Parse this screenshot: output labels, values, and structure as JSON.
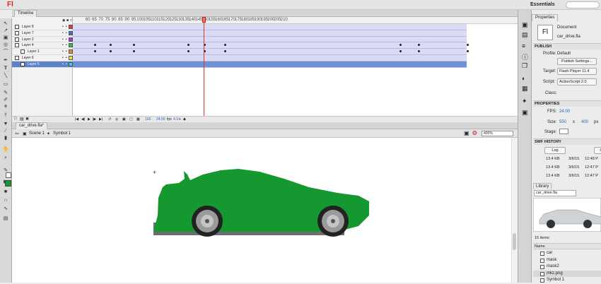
{
  "menubar": {
    "app_logo": "Fl",
    "workspace": "Essentials"
  },
  "timeline": {
    "tab_label": "Timeline",
    "ruler_ticks": [
      "60",
      "65",
      "70",
      "75",
      "80",
      "85",
      "90",
      "95",
      "100",
      "105",
      "110",
      "115",
      "120",
      "125",
      "130",
      "135",
      "140",
      "145",
      "150",
      "155",
      "160",
      "165",
      "170",
      "175",
      "180",
      "185",
      "190",
      "195",
      "200",
      "205",
      "210"
    ],
    "layers": [
      {
        "name": "Layer 8",
        "indent": 0,
        "color": "#e03a3a",
        "selected": false
      },
      {
        "name": "Layer 7",
        "indent": 0,
        "color": "#3a6ee0",
        "selected": false
      },
      {
        "name": "Layer 2",
        "indent": 0,
        "color": "#a03ad8",
        "selected": false
      },
      {
        "name": "Layer 4",
        "indent": 0,
        "color": "#2ec23a",
        "selected": false
      },
      {
        "name": "Layer 1",
        "indent": 1,
        "color": "#e08a2a",
        "selected": false
      },
      {
        "name": "Layer 6",
        "indent": 0,
        "color": "#e8e13a",
        "selected": false
      },
      {
        "name": "Layer 5",
        "indent": 1,
        "color": "#3ad2d2",
        "selected": true
      }
    ],
    "status": {
      "frame": "103",
      "fps": "24.00",
      "fps_unit": "fps",
      "time": "4.3",
      "time_unit": "s"
    }
  },
  "document": {
    "tab_label": "car_drive.fla*",
    "breadcrumb_scene": "Scene 1",
    "breadcrumb_symbol": "Symbol 1",
    "zoom": "400%"
  },
  "properties": {
    "tab_label": "Properties",
    "doc_icon_text": "Fl",
    "doc_type": "Document",
    "doc_name": "car_drive.fla",
    "publish": {
      "header": "PUBLISH",
      "profile_label": "Profile:",
      "profile_value": "Default",
      "settings_button": "Publish Settings...",
      "target_label": "Target:",
      "target_value": "Flash Player 11.4",
      "script_label": "Script:",
      "script_value": "ActionScript 2.0",
      "class_label": "Class:"
    },
    "props_section": {
      "header": "PROPERTIES",
      "fps_label": "FPS:",
      "fps_value": "24.00",
      "size_label": "Size:",
      "width": "550",
      "x_sep": "x",
      "height": "400",
      "unit": "px",
      "stage_label": "Stage:"
    },
    "swf_history": {
      "header": "SWF HISTORY",
      "log_button": "Log",
      "clear_button": "Clear",
      "entries": [
        {
          "size": "13.4 KB",
          "date": "3/6/15",
          "time": "12:48 P"
        },
        {
          "size": "13.4 KB",
          "date": "3/6/15",
          "time": "12:47 P"
        },
        {
          "size": "13.4 KB",
          "date": "3/6/15",
          "time": "12:47 P"
        }
      ]
    }
  },
  "library": {
    "tab_label": "Library",
    "doc_select": "car_drive.fla",
    "count": "15 items",
    "name_header": "Name",
    "items": [
      {
        "name": "car",
        "selected": false
      },
      {
        "name": "mask",
        "selected": false
      },
      {
        "name": "mask2",
        "selected": false
      },
      {
        "name": "mkz.png",
        "selected": true
      },
      {
        "name": "Symbol 1",
        "selected": false
      }
    ]
  },
  "colors": {
    "car_fill": "#14982f",
    "playhead": "#e0332c",
    "selected_layer": "#5c82c7",
    "frame_span": "#d9daf4"
  },
  "icons": [
    "selection-icon",
    "subselection-icon",
    "free-transform-icon",
    "3d-rotation-icon",
    "lasso-icon",
    "pen-icon",
    "text-icon",
    "line-icon",
    "rectangle-icon",
    "pencil-icon",
    "brush-icon",
    "deco-icon",
    "bone-icon",
    "paint-bucket-icon",
    "eyedropper-icon",
    "eraser-icon",
    "hand-icon",
    "zoom-icon"
  ]
}
